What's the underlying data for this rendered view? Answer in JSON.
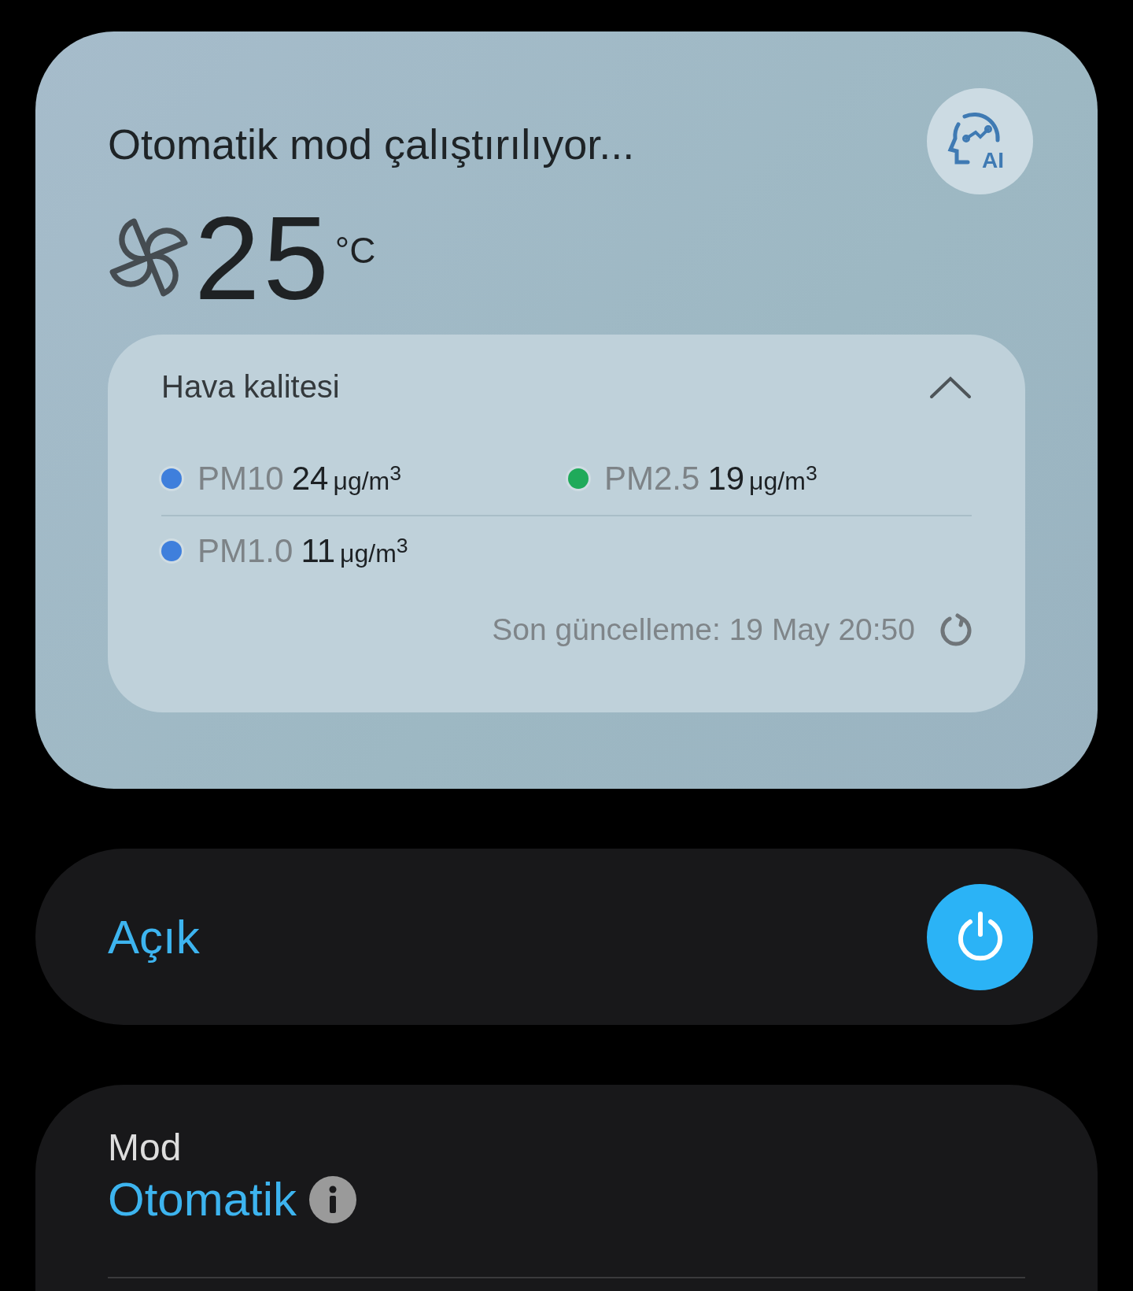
{
  "status_card": {
    "title": "Otomatik mod çalıştırılıyor...",
    "ai_button": {
      "label": "AI"
    },
    "temperature": {
      "value": "25",
      "unit": "°C"
    },
    "air_quality": {
      "title": "Hava kalitesi",
      "expanded": true,
      "readings": [
        {
          "label": "PM10",
          "value": "24",
          "unit": "μg/m$^{3}$",
          "color": "#3f7fdc"
        },
        {
          "label": "PM2.5",
          "value": "19",
          "unit": "μg/m$^{3}$",
          "color": "#1faa5a"
        },
        {
          "label": "PM1.0",
          "value": "11",
          "unit": "μg/m$^{3}$",
          "color": "#3f7fdc"
        }
      ],
      "last_update": "Son güncelleme: 19 May 20:50"
    }
  },
  "power_card": {
    "label": "Açık",
    "on": true
  },
  "mode_card": {
    "title": "Mod",
    "value": "Otomatik"
  }
}
